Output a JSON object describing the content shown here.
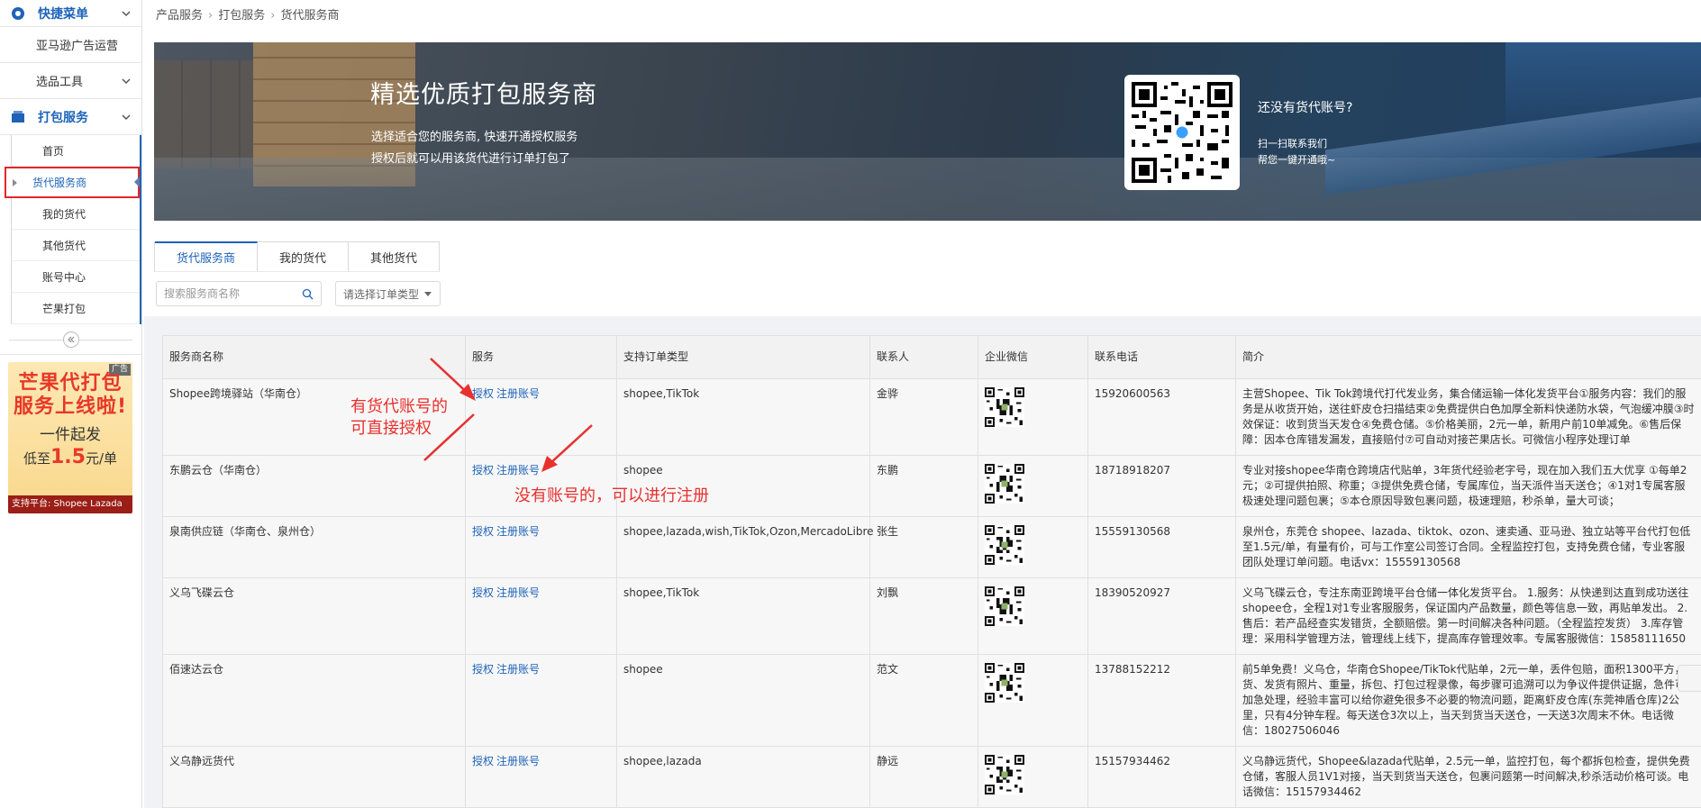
{
  "sidebar": {
    "quick_menu": "快捷菜单",
    "amazon_ads": "亚马逊广告运营",
    "select_tools": "选品工具",
    "packing_service": "打包服务",
    "items": [
      {
        "label": "首页"
      },
      {
        "label": "货代服务商"
      },
      {
        "label": "我的货代"
      },
      {
        "label": "其他货代"
      },
      {
        "label": "账号中心"
      },
      {
        "label": "芒果打包"
      }
    ]
  },
  "ad": {
    "tag": "广告",
    "line1": "芒果代打包",
    "line2": "服务上线啦!",
    "line3": "一件起发",
    "prefix": "低至",
    "price": "1.5",
    "unit": "元/单",
    "footer": "支持平台: Shopee Lazada"
  },
  "breadcrumb": [
    "产品服务",
    "打包服务",
    "货代服务商"
  ],
  "banner": {
    "title": "精选优质打包服务商",
    "sub1": "选择适合您的服务商, 快速开通授权服务",
    "sub2": "授权后就可以用该货代进行订单打包了",
    "question": "还没有货代账号?",
    "q1": "扫一扫联系我们",
    "q2": "帮您一键开通哦~"
  },
  "tabs": [
    "货代服务商",
    "我的货代",
    "其他货代"
  ],
  "search": {
    "placeholder": "搜索服务商名称"
  },
  "order_type_select": {
    "placeholder": "请选择订单类型"
  },
  "table": {
    "headers": [
      "服务商名称",
      "服务",
      "支持订单类型",
      "联系人",
      "企业微信",
      "联系电话",
      "简介"
    ],
    "auth_label": "授权",
    "register_label": "注册账号",
    "rows": [
      {
        "name": "Shopee跨境驿站（华南仓）",
        "types": "shopee,TikTok",
        "contact": "金骅",
        "phone": "15920600563",
        "intro": "主营Shopee、Tik Tok跨境代打代发业务，集合储运输一体化发货平台①服务内容：我们的服务是从收货开始，送往虾皮仓扫描结束②免费提供白色加厚全新料快递防水袋，气泡缓冲膜③时效保证：收到货当天发仓④免费仓储。⑤价格美丽，2元一单，新用户前10单减免。⑥售后保障：因本仓库错发漏发，直接赔付⑦可自动对接芒果店长。可微信小程序处理订单"
      },
      {
        "name": "东鹏云仓（华南仓）",
        "types": "shopee",
        "contact": "东鹏",
        "phone": "18718918207",
        "intro": "专业对接shopee华南仓跨境店代贴单，3年货代经验老字号，现在加入我们五大优享 ①每单2元；②可提供拍照、称重；③提供免费仓储，专属库位，当天派件当天送仓；④1对1专属客服极速处理问题包裹；⑤本仓原因导致包裹问题，极速理赔，秒杀单，量大可谈；"
      },
      {
        "name": "泉南供应链（华南仓、泉州仓）",
        "types": "shopee,lazada,wish,TikTok,Ozon,MercadoLibre",
        "contact": "张生",
        "phone": "15559130568",
        "intro": "泉州仓，东莞仓 shopee、lazada、tiktok、ozon、速卖通、亚马逊、独立站等平台代打包低至1.5元/单，有量有价，可与工作室公司签订合同。全程监控打包，支持免费仓储，专业客服团队处理订单问题。电话vx：15559130568"
      },
      {
        "name": "义乌飞碟云仓",
        "types": "shopee,TikTok",
        "contact": "刘飘",
        "phone": "18390520927",
        "intro": "义乌飞碟云仓，专注东南亚跨境平台仓储一体化发货平台。 1.服务：从快递到达直到成功送往shopee仓，全程1对1专业客服服务，保证国内产品数量，颜色等信息一致，再贴单发出。 2.售后：若产品经查实发错货，全额赔偿。第一时间解决各种问题。（全程监控发货） 3.库存管理：采用科学管理方法，管理线上线下，提高库存管理效率。专属客服微信：15858111650"
      },
      {
        "name": "佰速达云仓",
        "types": "shopee",
        "contact": "范文",
        "phone": "13788152212",
        "intro": "前5单免费！义乌仓，华南仓Shopee/TikTok代贴单，2元一单，丢件包赔，面积1300平方，货、发货有照片、重量，拆包、打包过程录像，每步骤可追溯可以为争议件提供证据，急件可加急处理，经验丰富可以给你避免很多不必要的物流问题，距离虾皮仓库(东莞神盾仓库)2公里，只有4分钟车程。每天送仓3次以上，当天到货当天送仓，一天送3次周末不休。电话微信：18027506046"
      },
      {
        "name": "义乌静远货代",
        "types": "shopee,lazada",
        "contact": "静远",
        "phone": "15157934462",
        "intro": "义乌静远货代，Shopee&lazada代贴单，2.5元一单，监控打包，每个都拆包检查，提供免费仓储，客服人员1V1对接，当天到货当天送仓，包裹问题第一时间解决,秒杀活动价格可谈。电话微信：15157934462"
      }
    ]
  },
  "annotations": {
    "has_account_1": "有货代账号的",
    "has_account_2": "可直接授权",
    "no_account": "没有账号的，可以进行注册"
  },
  "colors": {
    "accent": "#1e63b8",
    "annotation_red": "#e8302e",
    "highlight_border": "#e3262a"
  }
}
